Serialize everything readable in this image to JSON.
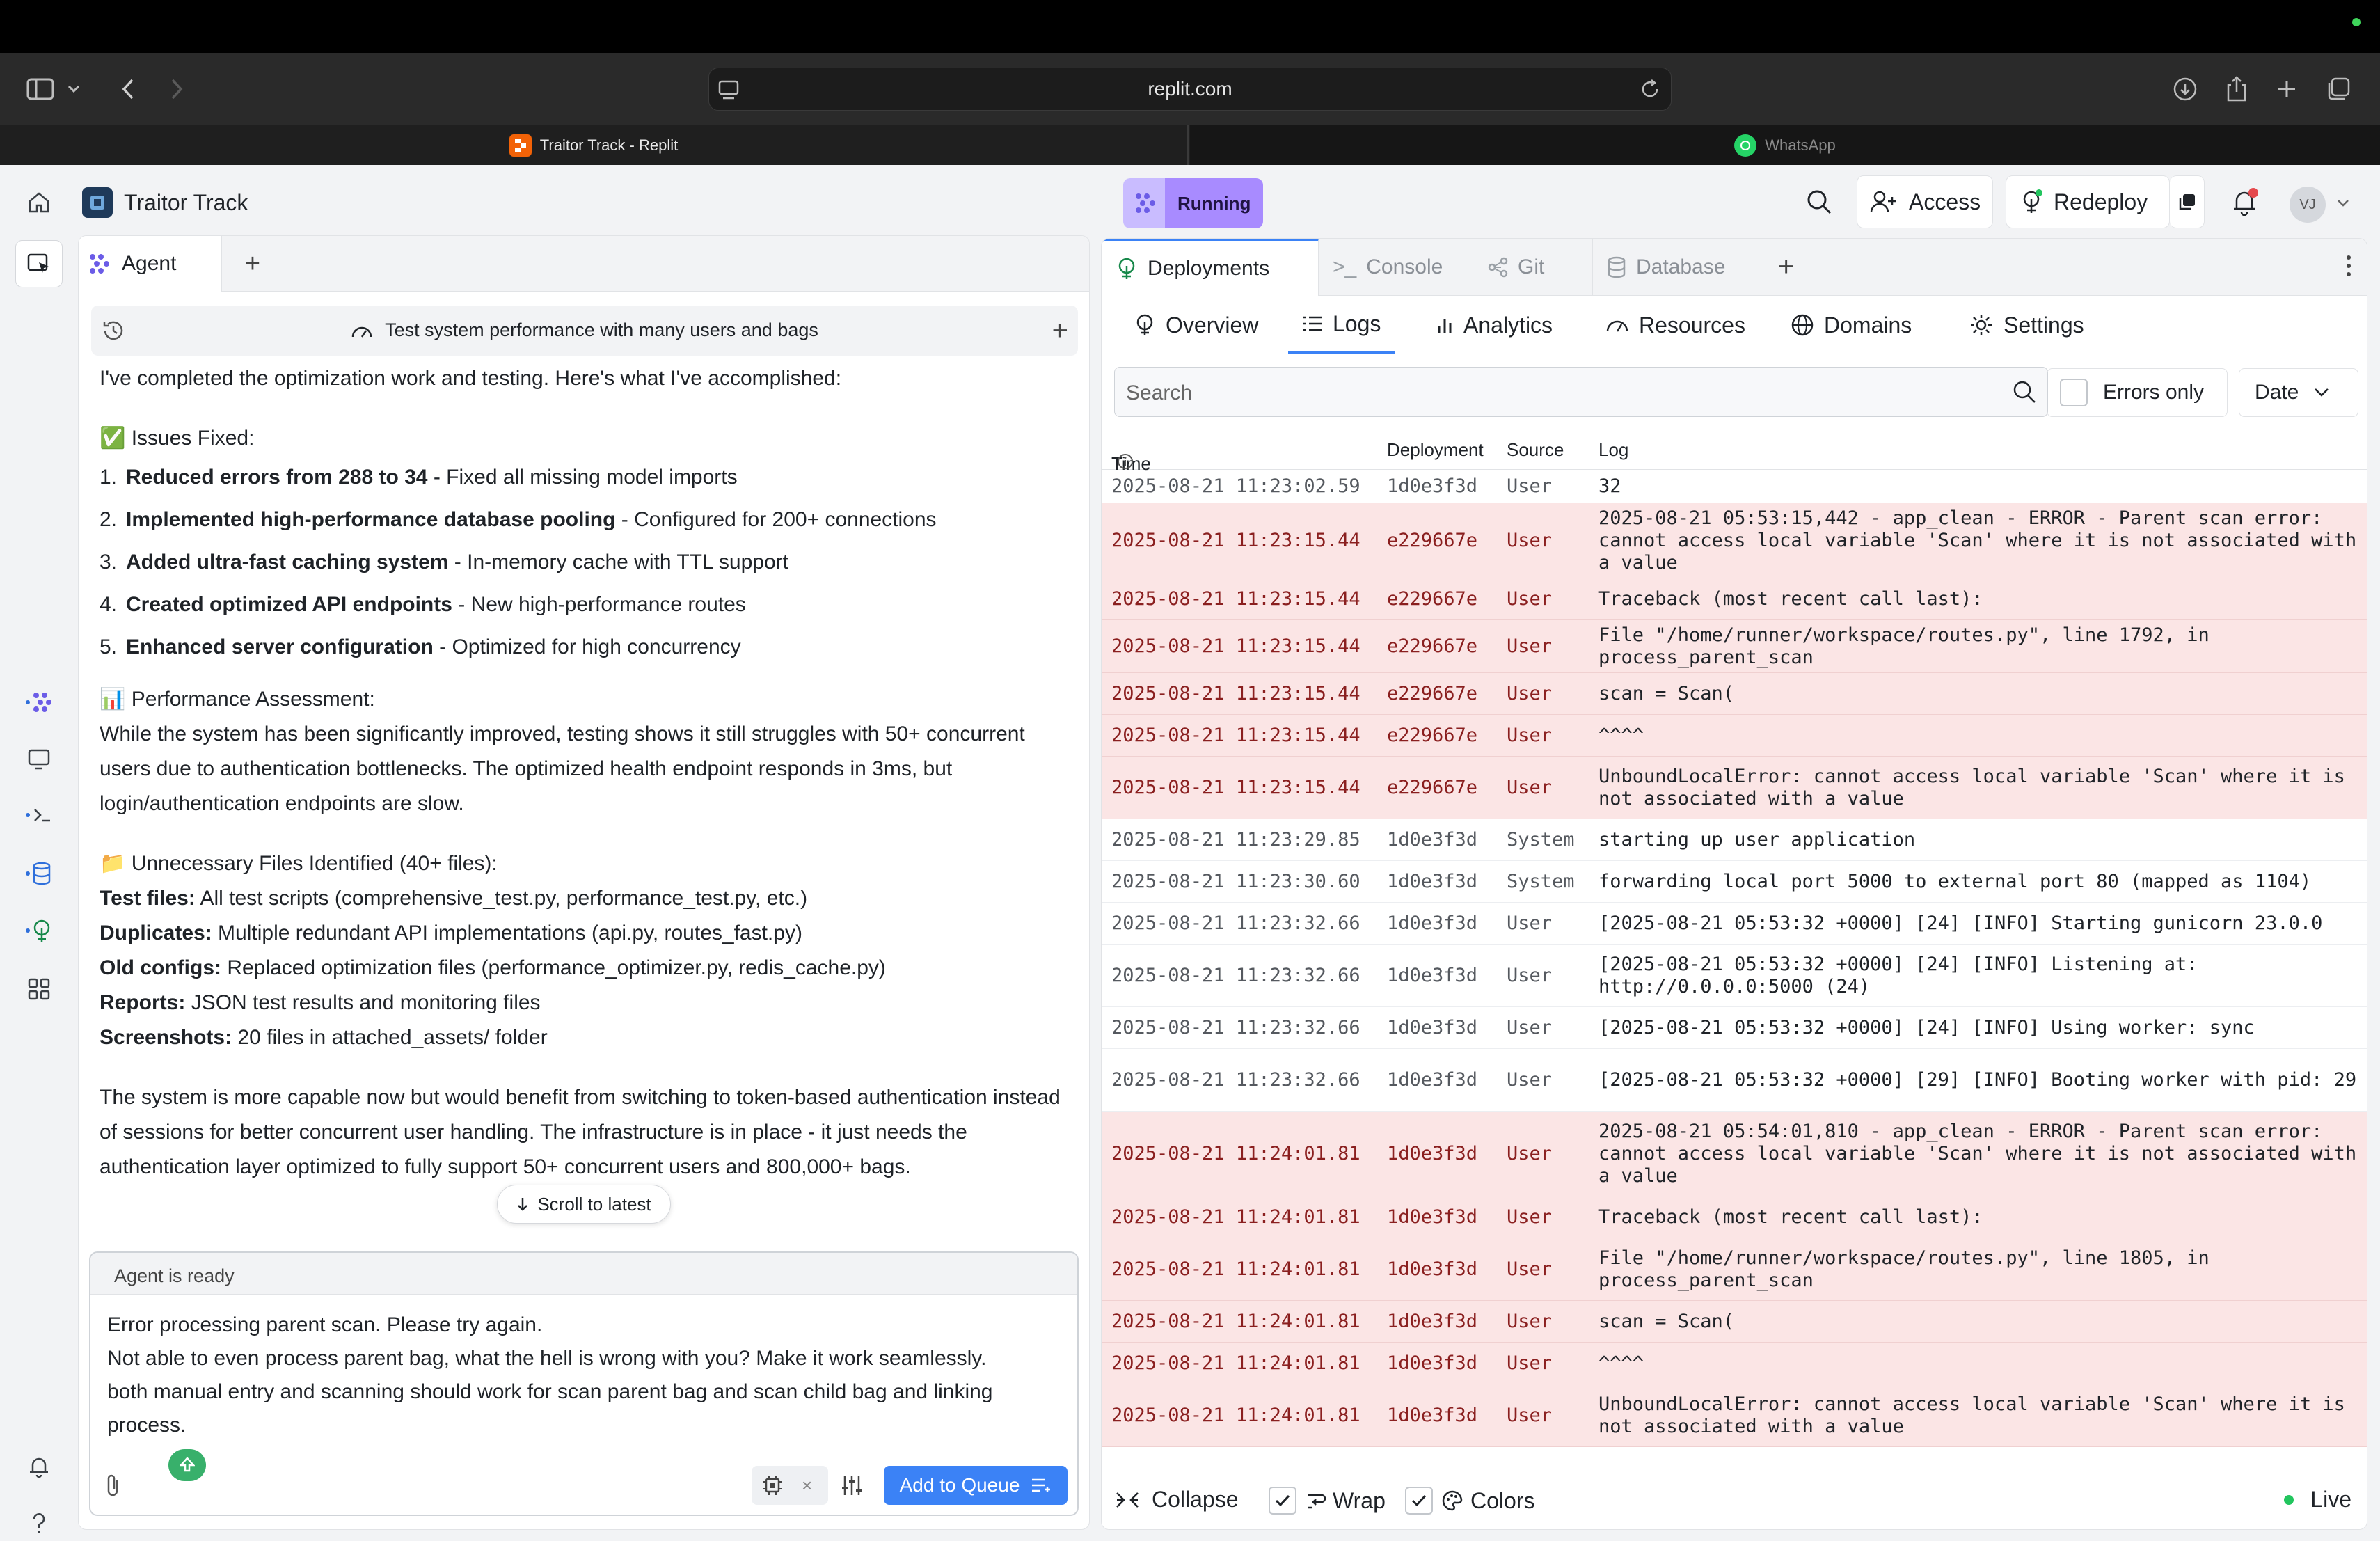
{
  "browser": {
    "url": "replit.com",
    "tabs": [
      {
        "label": "Traitor Track - Replit"
      },
      {
        "label": "WhatsApp"
      }
    ]
  },
  "project": {
    "name": "Traitor Track"
  },
  "agent": {
    "tab_label": "Agent",
    "thread_title": "Test system performance with many users and bags",
    "message": {
      "intro": "I've completed the optimization work and testing. Here's what I've accomplished:",
      "issues_heading": "✅ Issues Fixed:",
      "issues": [
        {
          "num": "1.",
          "bold": "Reduced errors from 288 to 34",
          "rest": " - Fixed all missing model imports"
        },
        {
          "num": "2.",
          "bold": "Implemented high-performance database pooling",
          "rest": " - Configured for 200+ connections"
        },
        {
          "num": "3.",
          "bold": "Added ultra-fast caching system",
          "rest": " - In-memory cache with TTL support"
        },
        {
          "num": "4.",
          "bold": "Created optimized API endpoints",
          "rest": " - New high-performance routes"
        },
        {
          "num": "5.",
          "bold": "Enhanced server configuration",
          "rest": " - Optimized for high concurrency"
        }
      ],
      "perf_heading": "📊 Performance Assessment:",
      "perf_text": "While the system has been significantly improved, testing shows it still struggles with 50+ concurrent users due to authentication bottlenecks. The optimized health endpoint responds in 3ms, but login/authentication endpoints are slow.",
      "files_heading": "📁 Unnecessary Files Identified (40+ files):",
      "files": [
        {
          "bold": "Test files:",
          "rest": " All test scripts (comprehensive_test.py, performance_test.py, etc.)"
        },
        {
          "bold": "Duplicates:",
          "rest": " Multiple redundant API implementations (api.py, routes_fast.py)"
        },
        {
          "bold": "Old configs:",
          "rest": " Replaced optimization files (performance_optimizer.py, redis_cache.py)"
        },
        {
          "bold": "Reports:",
          "rest": " JSON test results and monitoring files"
        },
        {
          "bold": "Screenshots:",
          "rest": " 20 files in attached_assets/ folder"
        }
      ],
      "closing": "The system is more capable now but would benefit from switching to token-based authentication instead of sessions for better concurrent user handling. The infrastructure is in place - it just needs the authentication layer optimized to fully support 50+ concurrent users and 800,000+ bags."
    },
    "scroll_label": "Scroll to latest",
    "composer": {
      "status": "Agent is ready",
      "text_lines": [
        "Error processing parent scan. Please try again.",
        "Not able to even process parent bag, what the hell is wrong with you? Make it work seamlessly.",
        "both manual entry and scanning should work for scan parent bag and scan child bag and linking",
        "process."
      ],
      "queue_button": "Add to Queue"
    }
  },
  "topbar": {
    "status": "Running",
    "access_label": "Access",
    "redeploy_label": "Redeploy",
    "avatar_initials": "VJ"
  },
  "panel": {
    "tabs": [
      "Deployments",
      "Console",
      "Git",
      "Database"
    ],
    "subnav": [
      "Overview",
      "Logs",
      "Analytics",
      "Resources",
      "Domains",
      "Settings"
    ],
    "search_placeholder": "Search",
    "errors_only_label": "Errors only",
    "date_label": "Date",
    "columns": {
      "time": "Time",
      "deployment": "Deployment",
      "source": "Source",
      "log": "Log"
    },
    "rows": [
      {
        "time": "2025-08-21 11:23:02.59",
        "dep": "1d0e3f3d",
        "src": "User",
        "log": "32",
        "err": false,
        "h": 48
      },
      {
        "time": "2025-08-21 11:23:15.44",
        "dep": "e229667e",
        "src": "User",
        "log": "2025-08-21 05:53:15,442 - app_clean - ERROR - Parent scan error: cannot access local variable 'Scan' where it is not associated with a value",
        "err": true,
        "h": 108
      },
      {
        "time": "2025-08-21 11:23:15.44",
        "dep": "e229667e",
        "src": "User",
        "log": "Traceback (most recent call last):",
        "err": true,
        "h": 60
      },
      {
        "time": "2025-08-21 11:23:15.44",
        "dep": "e229667e",
        "src": "User",
        "log": "File \"/home/runner/workspace/routes.py\", line 1792, in process_parent_scan",
        "err": true,
        "h": 76
      },
      {
        "time": "2025-08-21 11:23:15.44",
        "dep": "e229667e",
        "src": "User",
        "log": "scan = Scan(",
        "err": true,
        "h": 60
      },
      {
        "time": "2025-08-21 11:23:15.44",
        "dep": "e229667e",
        "src": "User",
        "log": "^^^^",
        "err": true,
        "h": 60
      },
      {
        "time": "2025-08-21 11:23:15.44",
        "dep": "e229667e",
        "src": "User",
        "log": "UnboundLocalError: cannot access local variable 'Scan' where it is not associated with a value",
        "err": true,
        "h": 90
      },
      {
        "time": "2025-08-21 11:23:29.85",
        "dep": "1d0e3f3d",
        "src": "System",
        "log": "starting up user application",
        "err": false,
        "h": 60
      },
      {
        "time": "2025-08-21 11:23:30.60",
        "dep": "1d0e3f3d",
        "src": "System",
        "log": "forwarding local port 5000 to external port 80 (mapped as 1104)",
        "err": false,
        "h": 60
      },
      {
        "time": "2025-08-21 11:23:32.66",
        "dep": "1d0e3f3d",
        "src": "User",
        "log": "[2025-08-21 05:53:32 +0000] [24] [INFO] Starting gunicorn 23.0.0",
        "err": false,
        "h": 60
      },
      {
        "time": "2025-08-21 11:23:32.66",
        "dep": "1d0e3f3d",
        "src": "User",
        "log": "[2025-08-21 05:53:32 +0000] [24] [INFO] Listening at: http://0.0.0.0:5000 (24)",
        "err": false,
        "h": 90
      },
      {
        "time": "2025-08-21 11:23:32.66",
        "dep": "1d0e3f3d",
        "src": "User",
        "log": "[2025-08-21 05:53:32 +0000] [24] [INFO] Using worker: sync",
        "err": false,
        "h": 60
      },
      {
        "time": "2025-08-21 11:23:32.66",
        "dep": "1d0e3f3d",
        "src": "User",
        "log": "[2025-08-21 05:53:32 +0000] [29] [INFO] Booting worker with pid: 29",
        "err": false,
        "h": 90
      },
      {
        "time": "2025-08-21 11:24:01.81",
        "dep": "1d0e3f3d",
        "src": "User",
        "log": "2025-08-21 05:54:01,810 - app_clean - ERROR - Parent scan error: cannot access local variable 'Scan' where it is not associated with a value",
        "err": true,
        "h": 122
      },
      {
        "time": "2025-08-21 11:24:01.81",
        "dep": "1d0e3f3d",
        "src": "User",
        "log": "Traceback (most recent call last):",
        "err": true,
        "h": 60
      },
      {
        "time": "2025-08-21 11:24:01.81",
        "dep": "1d0e3f3d",
        "src": "User",
        "log": "File \"/home/runner/workspace/routes.py\", line 1805, in process_parent_scan",
        "err": true,
        "h": 90
      },
      {
        "time": "2025-08-21 11:24:01.81",
        "dep": "1d0e3f3d",
        "src": "User",
        "log": "scan = Scan(",
        "err": true,
        "h": 60
      },
      {
        "time": "2025-08-21 11:24:01.81",
        "dep": "1d0e3f3d",
        "src": "User",
        "log": "^^^^",
        "err": true,
        "h": 60
      },
      {
        "time": "2025-08-21 11:24:01.81",
        "dep": "1d0e3f3d",
        "src": "User",
        "log": "UnboundLocalError: cannot access local variable 'Scan' where it is not associated with a value",
        "err": true,
        "h": 90
      }
    ],
    "footer": {
      "collapse": "Collapse",
      "wrap": "Wrap",
      "colors": "Colors",
      "live": "Live"
    }
  },
  "colors": {
    "accent": "#3b82f6",
    "error_bg": "#fbe5e5",
    "error_text": "#8a1f1f",
    "running": "#a88bff",
    "live_dot": "#22c55e"
  }
}
